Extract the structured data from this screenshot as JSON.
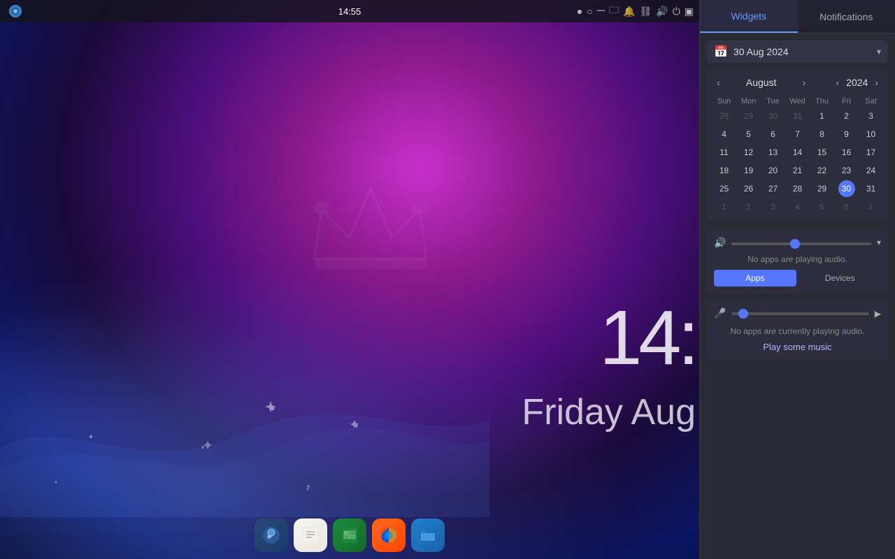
{
  "taskbar": {
    "time": "14:55",
    "indicators": [
      "●",
      "○"
    ],
    "icons": {
      "minimize": "─",
      "folder": "🗀",
      "bell": "🔔",
      "link": "🔗",
      "volume": "🔊",
      "power": "⏻",
      "screen": "▣"
    }
  },
  "desktop": {
    "clock": "14:",
    "date": "Friday Aug",
    "crown_symbol": "♛"
  },
  "dock": {
    "items": [
      {
        "id": "steam",
        "label": "Steam",
        "emoji": "🎮"
      },
      {
        "id": "notes",
        "label": "Notes",
        "emoji": "📝"
      },
      {
        "id": "sheets",
        "label": "Sheets",
        "emoji": "📊"
      },
      {
        "id": "firefox",
        "label": "Firefox",
        "emoji": "🦊"
      },
      {
        "id": "files",
        "label": "Files",
        "emoji": "📁"
      }
    ]
  },
  "right_panel": {
    "tab_widgets": "Widgets",
    "tab_notifications": "Notifications",
    "date_header": "30 Aug 2024",
    "calendar": {
      "month": "August",
      "year": "2024",
      "day_headers": [
        "Sun",
        "Mon",
        "Tue",
        "Wed",
        "Thu",
        "Fri",
        "Sat"
      ],
      "weeks": [
        [
          {
            "day": "28",
            "other": true
          },
          {
            "day": "29",
            "other": true
          },
          {
            "day": "30",
            "other": true
          },
          {
            "day": "31",
            "other": true
          },
          {
            "day": "1",
            "other": false
          },
          {
            "day": "2",
            "other": false
          },
          {
            "day": "3",
            "other": false
          }
        ],
        [
          {
            "day": "4",
            "other": false
          },
          {
            "day": "5",
            "other": false
          },
          {
            "day": "6",
            "other": false
          },
          {
            "day": "7",
            "other": false
          },
          {
            "day": "8",
            "other": false
          },
          {
            "day": "9",
            "other": false
          },
          {
            "day": "10",
            "other": false
          }
        ],
        [
          {
            "day": "11",
            "other": false
          },
          {
            "day": "12",
            "other": false
          },
          {
            "day": "13",
            "other": false
          },
          {
            "day": "14",
            "other": false
          },
          {
            "day": "15",
            "other": false
          },
          {
            "day": "16",
            "other": false
          },
          {
            "day": "17",
            "other": false
          }
        ],
        [
          {
            "day": "18",
            "other": false
          },
          {
            "day": "19",
            "other": false
          },
          {
            "day": "20",
            "other": false
          },
          {
            "day": "21",
            "other": false
          },
          {
            "day": "22",
            "other": false
          },
          {
            "day": "23",
            "other": false
          },
          {
            "day": "24",
            "other": false
          }
        ],
        [
          {
            "day": "25",
            "other": false
          },
          {
            "day": "26",
            "other": false
          },
          {
            "day": "27",
            "other": false
          },
          {
            "day": "28",
            "other": false
          },
          {
            "day": "29",
            "other": false
          },
          {
            "day": "30",
            "today": true
          },
          {
            "day": "31",
            "other": false
          }
        ],
        [
          {
            "day": "1",
            "other": true
          },
          {
            "day": "2",
            "other": true
          },
          {
            "day": "3",
            "other": true
          },
          {
            "day": "4",
            "other": true
          },
          {
            "day": "5",
            "other": true
          },
          {
            "day": "6",
            "other": true
          },
          {
            "day": "7",
            "other": true
          }
        ]
      ]
    },
    "volume": {
      "no_audio_text": "No apps are playing audio.",
      "tab_apps": "Apps",
      "tab_devices": "Devices",
      "slider_value": 45
    },
    "mic": {
      "no_playing_text": "No apps are currently playing audio.",
      "play_music_label": "Play some music",
      "slider_value": 5
    }
  }
}
